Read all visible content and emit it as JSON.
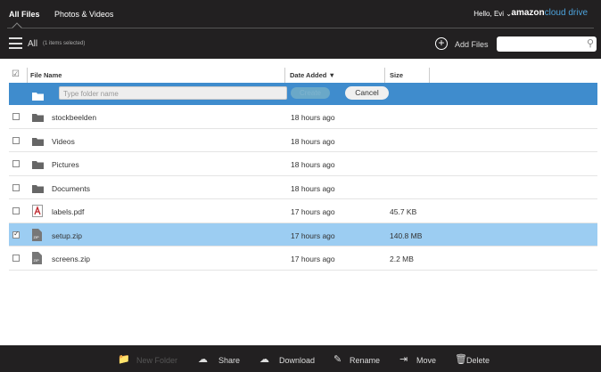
{
  "nav": {
    "tabs": [
      "All Files",
      "Photos & Videos"
    ],
    "greeting": "Hello, Evi",
    "logo_a": "amazon",
    "logo_b": "cloud drive"
  },
  "toolbar": {
    "location": "All",
    "selection": "(1 items selected)",
    "add_files": "Add Files",
    "search_placeholder": ""
  },
  "columns": {
    "name": "File Name",
    "date": "Date Added",
    "size": "Size"
  },
  "new_folder": {
    "placeholder": "Type folder name",
    "create": "Create",
    "cancel": "Cancel"
  },
  "files": [
    {
      "name": "stockbeelden",
      "type": "folder",
      "date": "18 hours ago",
      "size": ""
    },
    {
      "name": "Videos",
      "type": "folder",
      "date": "18 hours ago",
      "size": ""
    },
    {
      "name": "Pictures",
      "type": "folder",
      "date": "18 hours ago",
      "size": ""
    },
    {
      "name": "Documents",
      "type": "folder",
      "date": "18 hours ago",
      "size": ""
    },
    {
      "name": "labels.pdf",
      "type": "pdf",
      "date": "17 hours ago",
      "size": "45.7 KB"
    },
    {
      "name": "setup.zip",
      "type": "zip",
      "date": "17 hours ago",
      "size": "140.8 MB",
      "selected": true
    },
    {
      "name": "screens.zip",
      "type": "zip",
      "date": "17 hours ago",
      "size": "2.2 MB"
    }
  ],
  "actions": [
    "New Folder",
    "Share",
    "Download",
    "Rename",
    "Move",
    "Delete"
  ]
}
